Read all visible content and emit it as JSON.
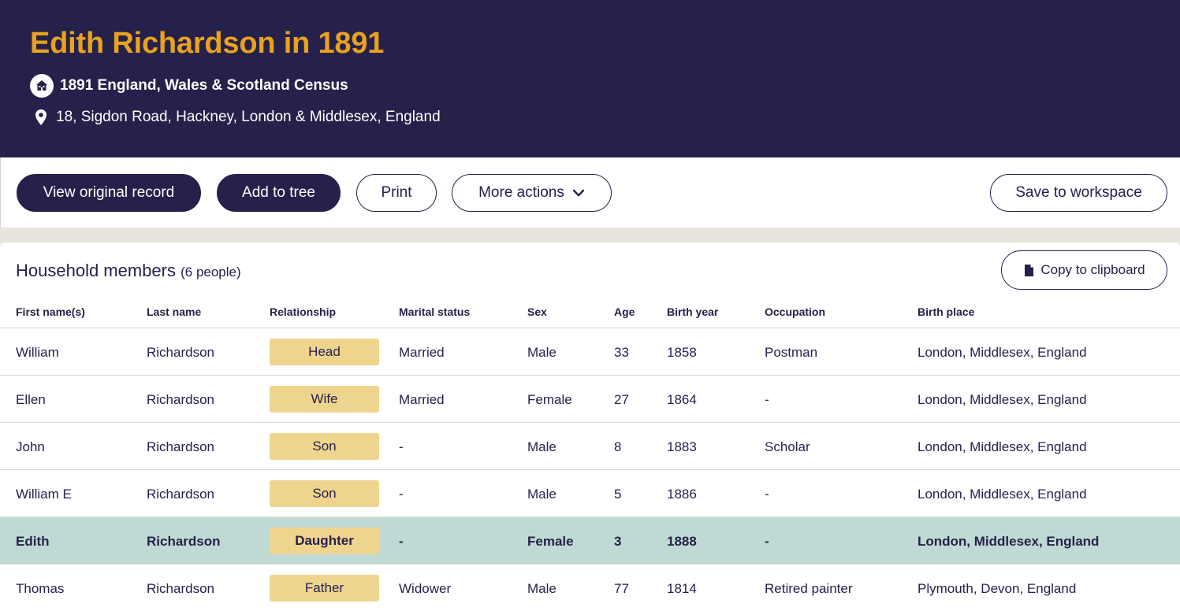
{
  "header": {
    "title": "Edith Richardson in 1891",
    "collection": "1891 England, Wales & Scotland Census",
    "address": "18, Sigdon Road, Hackney, London & Middlesex, England"
  },
  "icons": {
    "census": "house-icon",
    "address": "location-pin-icon",
    "more_actions": "chevron-down-icon",
    "copy": "document-icon"
  },
  "colors": {
    "header_bg": "#25214a",
    "title": "#e8a21f",
    "badge": "#efd48e",
    "highlight_row": "#bfdad4"
  },
  "actions": {
    "view_original": "View original record",
    "add_to_tree": "Add to tree",
    "print": "Print",
    "more_actions": "More actions",
    "save_workspace": "Save to workspace"
  },
  "household": {
    "title": "Household members",
    "count": "(6 people)",
    "copy_label": "Copy to clipboard",
    "columns": [
      "First name(s)",
      "Last name",
      "Relationship",
      "Marital status",
      "Sex",
      "Age",
      "Birth year",
      "Occupation",
      "Birth place"
    ],
    "rows": [
      {
        "first": "William",
        "last": "Richardson",
        "relationship": "Head",
        "marital": "Married",
        "sex": "Male",
        "age": "33",
        "birth_year": "1858",
        "occupation": "Postman",
        "birth_place": "London, Middlesex, England"
      },
      {
        "first": "Ellen",
        "last": "Richardson",
        "relationship": "Wife",
        "marital": "Married",
        "sex": "Female",
        "age": "27",
        "birth_year": "1864",
        "occupation": "-",
        "birth_place": "London, Middlesex, England"
      },
      {
        "first": "John",
        "last": "Richardson",
        "relationship": "Son",
        "marital": "-",
        "sex": "Male",
        "age": "8",
        "birth_year": "1883",
        "occupation": "Scholar",
        "birth_place": "London, Middlesex, England"
      },
      {
        "first": "William E",
        "last": "Richardson",
        "relationship": "Son",
        "marital": "-",
        "sex": "Male",
        "age": "5",
        "birth_year": "1886",
        "occupation": "-",
        "birth_place": "London, Middlesex, England"
      },
      {
        "first": "Edith",
        "last": "Richardson",
        "relationship": "Daughter",
        "marital": "-",
        "sex": "Female",
        "age": "3",
        "birth_year": "1888",
        "occupation": "-",
        "birth_place": "London, Middlesex, England"
      },
      {
        "first": "Thomas",
        "last": "Richardson",
        "relationship": "Father",
        "marital": "Widower",
        "sex": "Male",
        "age": "77",
        "birth_year": "1814",
        "occupation": "Retired painter",
        "birth_place": "Plymouth, Devon, England"
      }
    ]
  }
}
